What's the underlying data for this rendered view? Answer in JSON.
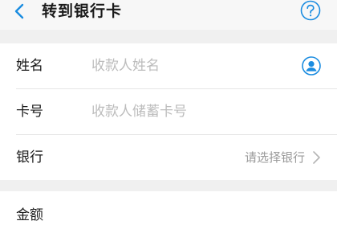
{
  "header": {
    "title": "转到银行卡",
    "back_icon": "chevron-left-icon",
    "help_icon": "question-circle-icon"
  },
  "form": {
    "name": {
      "label": "姓名",
      "placeholder": "收款人姓名",
      "icon": "contact-person-icon"
    },
    "card_number": {
      "label": "卡号",
      "placeholder": "收款人储蓄卡号"
    },
    "bank": {
      "label": "银行",
      "select_text": "请选择银行",
      "icon": "chevron-right-icon"
    }
  },
  "amount": {
    "label": "金额"
  },
  "colors": {
    "accent": "#1a8ce0",
    "background": "#f0f0f0",
    "card": "#ffffff",
    "placeholder": "#bcbcbc"
  }
}
